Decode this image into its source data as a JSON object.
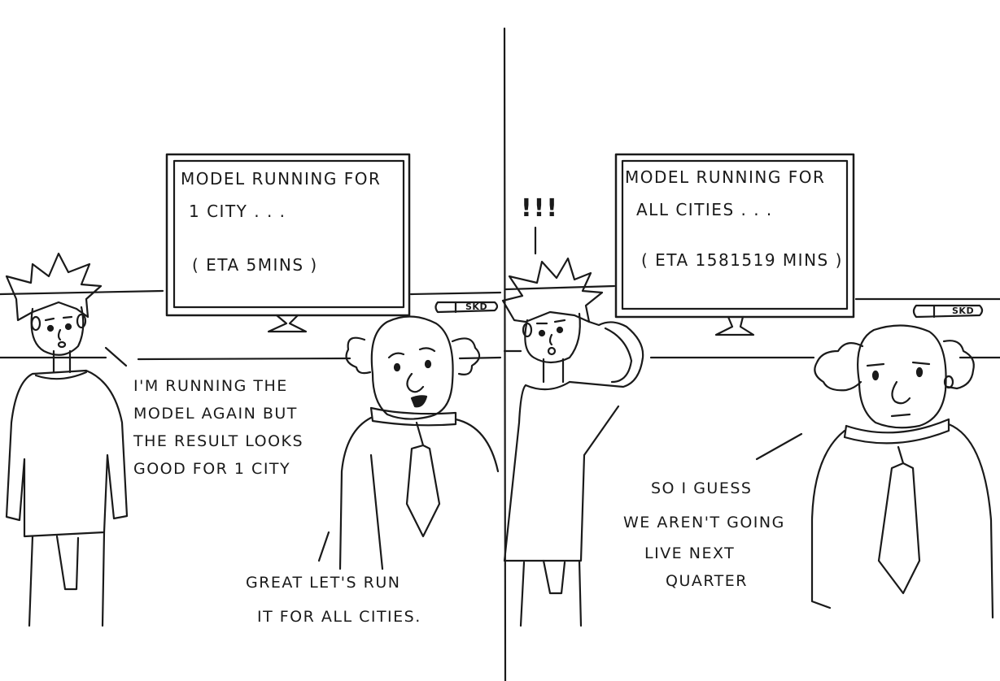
{
  "panels": {
    "left": {
      "monitor": {
        "line1": "MODEL RUNNING FOR",
        "line2": "1 CITY . . .",
        "eta": "( ETA 5MINS )"
      },
      "speech_employee": [
        "I'M RUNNING THE",
        "MODEL AGAIN BUT",
        "THE RESULT LOOKS",
        "GOOD FOR 1 CITY"
      ],
      "speech_boss": [
        "GREAT LET'S RUN",
        "IT FOR ALL CITIES."
      ],
      "marker_label": "SKD"
    },
    "right": {
      "exclamation": "!!!",
      "monitor": {
        "line1": "MODEL RUNNING FOR",
        "line2": "ALL CITIES . . .",
        "eta": "( ETA 1581519 MINS )"
      },
      "speech_boss": [
        "SO I GUESS",
        "WE AREN'T GOING",
        "LIVE NEXT",
        "QUARTER"
      ],
      "marker_label": "SKD"
    }
  },
  "colors": {
    "ink": "#1a1a1a",
    "paper": "#ffffff"
  }
}
